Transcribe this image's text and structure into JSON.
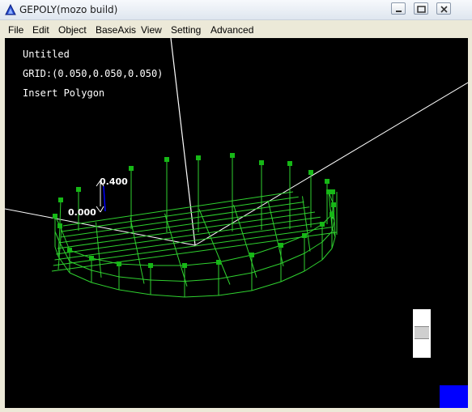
{
  "window": {
    "title": "GEPOLY(mozo build)"
  },
  "menu": {
    "items": [
      "File",
      "Edit",
      "Object",
      "BaseAxis",
      "View",
      "Setting",
      "Advanced"
    ]
  },
  "viewport": {
    "doc_name": "Untitled",
    "grid_info": "GRID:(0.050,0.050,0.050)",
    "mode": "Insert Polygon",
    "height_label_top": "0.400",
    "height_label_bottom": "0.000"
  },
  "colors": {
    "background": "#000000",
    "grid_line": "#2fd12f",
    "vertex": "#16b816",
    "axis": "#ffffff",
    "indicator": "#0000ff"
  }
}
